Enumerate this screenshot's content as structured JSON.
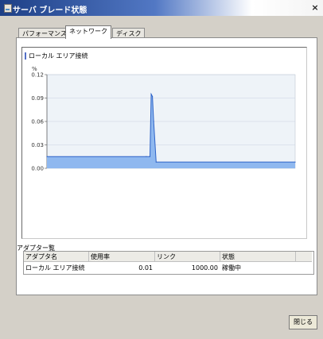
{
  "window": {
    "title": "サーバ ブレード状態",
    "close_glyph": "×"
  },
  "tabs": [
    {
      "label": "パフォーマンス",
      "active": false
    },
    {
      "label": "ネットワーク",
      "active": true
    },
    {
      "label": "ディスク",
      "active": false
    }
  ],
  "chart_data": {
    "type": "area",
    "title": "ローカル エリア接続",
    "ylabel": "%",
    "ylim": [
      0,
      0.12
    ],
    "y_ticks": [
      "0.12",
      "0.09",
      "0.06",
      "0.03",
      "0.00"
    ],
    "x": [
      0,
      0.4,
      0.415,
      0.42,
      0.425,
      0.43,
      0.44,
      1
    ],
    "values": [
      0.015,
      0.015,
      0.015,
      0.095,
      0.092,
      0.06,
      0.008,
      0.008
    ],
    "grid": true,
    "colors": {
      "fill": "#8fb8ef",
      "line": "#2d63c8",
      "plot_bg": "#eef3f8",
      "grid": "#c9d2e2"
    }
  },
  "adapter_list": {
    "title": "アダプター覧",
    "columns": [
      "アダプタ名",
      "使用率",
      "リンク",
      "状態"
    ],
    "rows": [
      {
        "name": "ローカル エリア接続",
        "usage": "0.01",
        "link": "1000.00",
        "status": "稼働中"
      }
    ]
  },
  "buttons": {
    "close": "閉じる"
  }
}
